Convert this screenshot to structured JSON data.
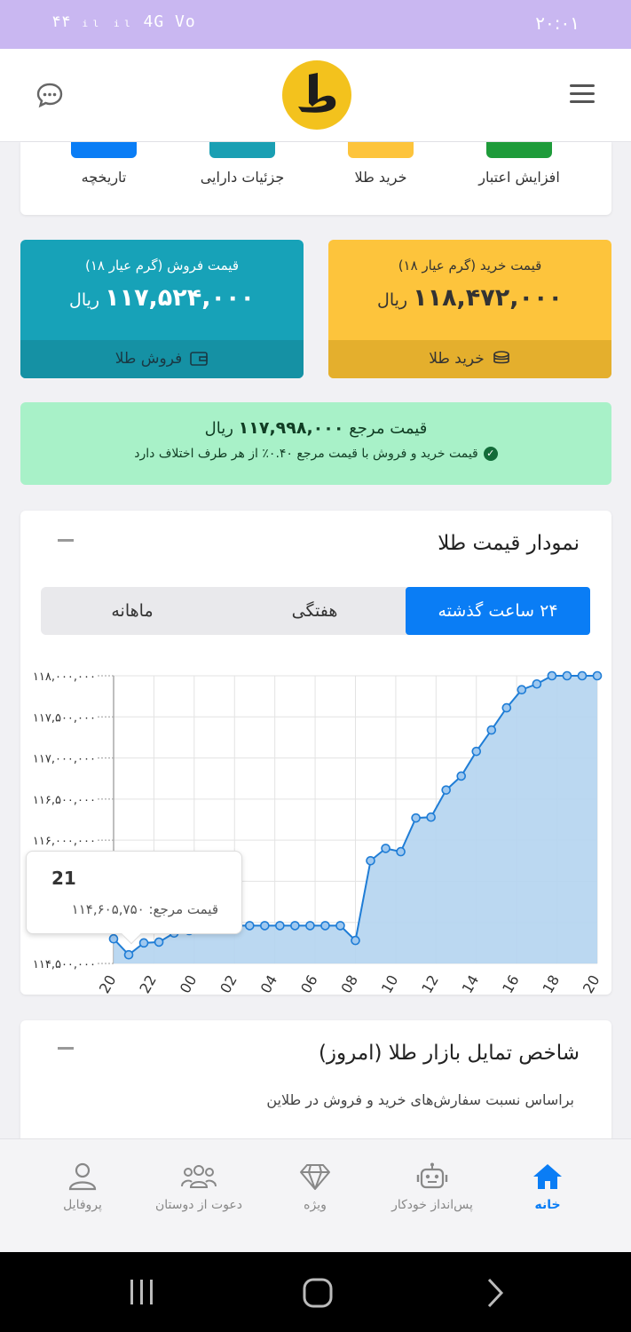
{
  "status_bar": {
    "left_text": "۴۴ ᵢₗ ᵢₗ 4G Vo",
    "time": "۲۰:۰۱"
  },
  "header": {
    "logo_icon": "gold-logo",
    "menu_icon": "hamburger-icon",
    "chat_icon": "chat-icon"
  },
  "quick_actions": [
    {
      "label": "افزایش اعتبار",
      "color": "#1e9b3a"
    },
    {
      "label": "خرید طلا",
      "color": "#fdc43c"
    },
    {
      "label": "جزئیات دارایی",
      "color": "#1a9fb3"
    },
    {
      "label": "تاریخچه",
      "color": "#0a7df5"
    }
  ],
  "buy_card": {
    "caption": "قیمت خرید (گرم عیار ۱۸)",
    "price": "۱۱۸,۴۷۲,۰۰۰",
    "unit": "ریال",
    "action": "خرید طلا",
    "color": "#fdc43c"
  },
  "sell_card": {
    "caption": "قیمت فروش (گرم عیار ۱۸)",
    "price": "۱۱۷,۵۲۴,۰۰۰",
    "unit": "ریال",
    "action": "فروش طلا",
    "color": "#17a2b8"
  },
  "reference": {
    "label": "قیمت مرجع",
    "price": "۱۱۷,۹۹۸,۰۰۰",
    "unit": "ریال",
    "note": "قیمت خرید و فروش با قیمت مرجع ۰.۴۰٪ از هر طرف اختلاف دارد"
  },
  "chart_card": {
    "title": "نمودار قیمت طلا",
    "tabs": [
      "۲۴ ساعت گذشته",
      "هفتگی",
      "ماهانه"
    ],
    "active_tab": 0,
    "tooltip": {
      "title": "21",
      "label": "قیمت مرجع:",
      "value": "۱۱۴,۶۰۵,۷۵۰"
    }
  },
  "chart_data": {
    "type": "area",
    "x": [
      20,
      20.75,
      21.5,
      22.25,
      23,
      23.75,
      0.5,
      1.25,
      2,
      2.75,
      3.5,
      4.25,
      5,
      5.75,
      6.5,
      7.25,
      8,
      8.75,
      9.5,
      10.25,
      11,
      11.75,
      12.5,
      13.25,
      14,
      14.75,
      15.5,
      16.25,
      17,
      17.75,
      18.5,
      19.25,
      20
    ],
    "values": [
      114800000,
      114605750,
      114750000,
      114760000,
      114870000,
      114900000,
      114950000,
      114950000,
      114960000,
      114960000,
      114960000,
      114960000,
      114960000,
      114960000,
      114960000,
      114960000,
      114780000,
      115750000,
      115900000,
      115860000,
      116270000,
      116280000,
      116610000,
      116780000,
      117080000,
      117340000,
      117610000,
      117830000,
      117900000,
      118000000,
      118000000,
      118000000,
      118000000
    ],
    "x_ticks": [
      "20",
      "22",
      "00",
      "02",
      "04",
      "06",
      "08",
      "10",
      "12",
      "14",
      "16",
      "18",
      "20"
    ],
    "y_ticks": [
      "۱۱۴,۵۰۰,۰۰۰",
      "۱۱۵,۰۰۰,۰۰۰",
      "۱۱۵,۵۰۰,۰۰۰",
      "۱۱۶,۰۰۰,۰۰۰",
      "۱۱۶,۵۰۰,۰۰۰",
      "۱۱۷,۰۰۰,۰۰۰",
      "۱۱۷,۵۰۰,۰۰۰",
      "۱۱۸,۰۰۰,۰۰۰"
    ],
    "ylim": [
      114500000,
      118000000
    ],
    "grid": true,
    "line_color": "#1f7dd6",
    "fill_color": "#b4d4ef"
  },
  "sentiment_card": {
    "title": "شاخص تمایل بازار طلا (امروز)",
    "subtitle": "براساس نسبت سفارش‌های خرید و فروش در طلاین"
  },
  "bottom_nav": [
    {
      "label": "خانه",
      "icon": "home-icon",
      "active": true
    },
    {
      "label": "پس‌انداز خودکار",
      "icon": "robot-icon",
      "active": false
    },
    {
      "label": "ویژه",
      "icon": "diamond-icon",
      "active": false
    },
    {
      "label": "دعوت از دوستان",
      "icon": "users-icon",
      "active": false
    },
    {
      "label": "پروفایل",
      "icon": "user-icon",
      "active": false
    }
  ],
  "system_nav": [
    "recents-icon",
    "home-circle-icon",
    "back-icon"
  ]
}
